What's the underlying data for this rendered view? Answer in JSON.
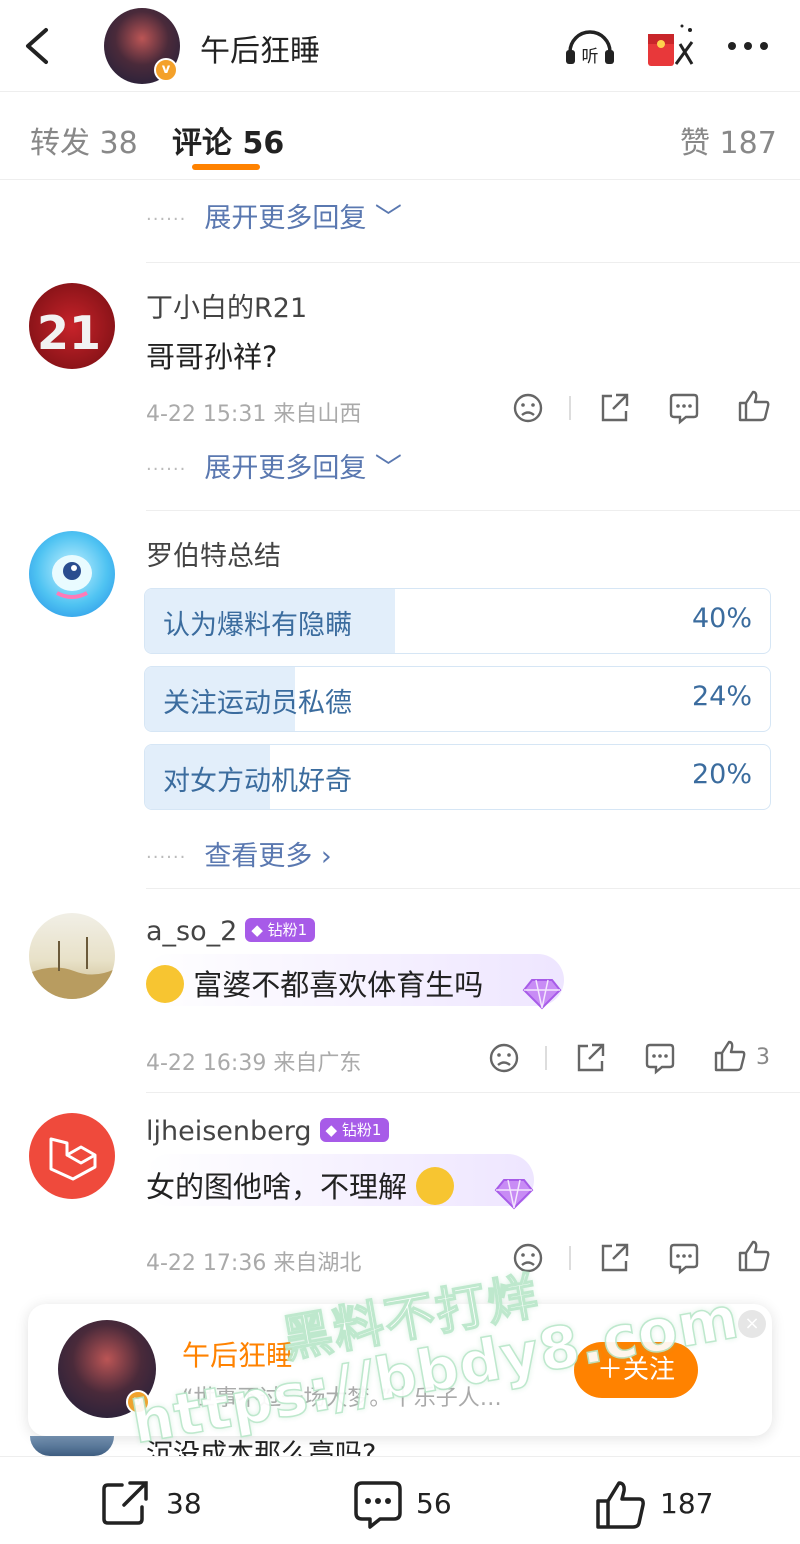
{
  "header": {
    "title": "午后狂睡",
    "listen_label": "听"
  },
  "tabs": {
    "repost": "转发 38",
    "comments": "评论 56",
    "likes": "赞 187"
  },
  "expand_more": "展开更多回复",
  "comments": [
    {
      "username": "丁小白的R21",
      "text": "哥哥孙祥?",
      "meta": "4-22 15:31  来自山西",
      "likes": ""
    },
    {
      "username": "a_so_2",
      "badge": "钻粉1",
      "text": "富婆不都喜欢体育生吗",
      "meta": "4-22 16:39  来自广东",
      "likes": "3"
    },
    {
      "username": "ljheisenberg",
      "badge": "钻粉1",
      "text": "女的图他啥，不理解",
      "meta": "4-22 17:36  来自湖北",
      "likes": ""
    }
  ],
  "poll": {
    "username": "罗伯特总结",
    "options": [
      {
        "label": "认为爆料有隐瞒",
        "pct_text": "40%",
        "pct": 40
      },
      {
        "label": "关注运动员私德",
        "pct_text": "24%",
        "pct": 24
      },
      {
        "label": "对女方动机好奇",
        "pct_text": "20%",
        "pct": 20
      }
    ],
    "view_more": "查看更多"
  },
  "follow_card": {
    "name": "午后狂睡",
    "signature": "“世事不过一场大梦。”丨乐子人…",
    "follow_label": "＋关注",
    "close": "×"
  },
  "partial_comment": "沉没成本那么高吗?",
  "bottom_bar": {
    "repost_count": "38",
    "comment_count": "56",
    "like_count": "187"
  },
  "watermark": {
    "line1": "黑料不打烊",
    "line2": "https://bbdy8.com"
  },
  "colors": {
    "accent": "#ff8200",
    "link": "#5a78b0",
    "poll_text": "#3b6c9e",
    "poll_fill": "#e2eefa",
    "fan_badge": "#a75be8"
  }
}
